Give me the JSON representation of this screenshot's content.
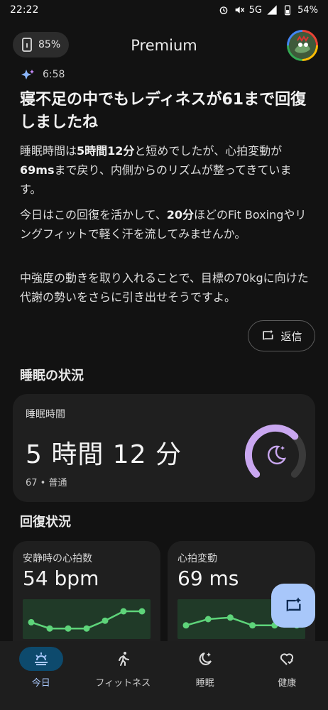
{
  "status_bar": {
    "time": "22:22",
    "network": "5G",
    "battery": "54%"
  },
  "top_bar": {
    "device_battery": "85%",
    "title": "Premium"
  },
  "message": {
    "time": "6:58",
    "headline": "寝不足の中でもレディネスが61まで回復しましたね",
    "paragraph1_parts": [
      "睡眠時間は",
      "5時間12分",
      "と短めでしたが、心拍変動が",
      "69ms",
      "まで戻り、内側からのリズムが整ってきています。"
    ],
    "paragraph2_parts": [
      "今日はこの回復を活かして、",
      "20分",
      "ほどの",
      "Fit Boxing",
      "やリングフィットで軽く汗を流してみませんか。"
    ],
    "paragraph3": "中強度の動きを取り入れることで、目標の70kgに向けた代謝の勢いをさらに引き出せそうですよ。",
    "reply_label": "返信"
  },
  "sleep_section": {
    "title": "睡眠の状況",
    "card_label": "睡眠時間",
    "value": "5 時間 12 分",
    "sub": "67 • 普通",
    "score_fraction": 0.67
  },
  "recovery_section": {
    "title": "回復状況",
    "resting_hr": {
      "label": "安静時の心拍数",
      "value": "54 bpm",
      "trend": [
        0.4,
        0.2,
        0.2,
        0.2,
        0.45,
        0.75,
        0.75
      ]
    },
    "hrv": {
      "label": "心拍変動",
      "value": "69 ms",
      "trend": [
        0.3,
        0.5,
        0.55,
        0.3,
        0.3,
        0.3
      ]
    }
  },
  "bottom_nav": [
    {
      "label": "今日",
      "active": true
    },
    {
      "label": "フィットネス",
      "active": false
    },
    {
      "label": "睡眠",
      "active": false
    },
    {
      "label": "健康",
      "active": false
    }
  ],
  "colors": {
    "accent": "#a8c7fa",
    "gauge": "#c9a7f0",
    "trend_line": "#5ed47a",
    "nav_active_pill": "#0d4a6d"
  }
}
